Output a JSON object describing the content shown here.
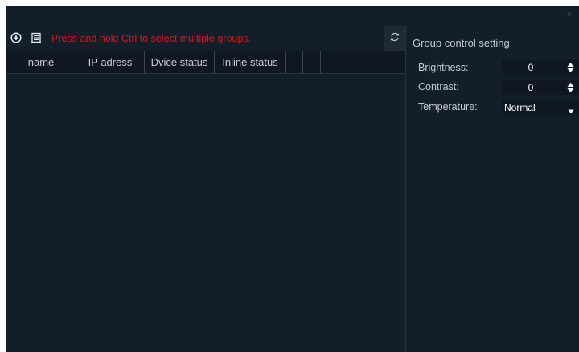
{
  "window": {
    "close_glyph": "×"
  },
  "toolbar": {
    "add_icon": "circle-plus-icon",
    "group_icon": "document-icon",
    "hint": "Press and hold Ctrl to select multiple groups.",
    "hint_color": "#d11a1a",
    "refresh_icon": "refresh-icon"
  },
  "table": {
    "columns": [
      "name",
      "IP adress",
      "Dvice status",
      "Inline status",
      "",
      ""
    ],
    "rows": []
  },
  "group_control": {
    "title": "Group control setting",
    "brightness": {
      "label": "Brightness:",
      "value": "0"
    },
    "contrast": {
      "label": "Contrast:",
      "value": "0"
    },
    "temperature": {
      "label": "Temperature:",
      "value": "Normal"
    }
  },
  "colors": {
    "background": "#131e2b",
    "header": "#0f1822",
    "text": "#c3cad2",
    "field": "#0f1822"
  }
}
